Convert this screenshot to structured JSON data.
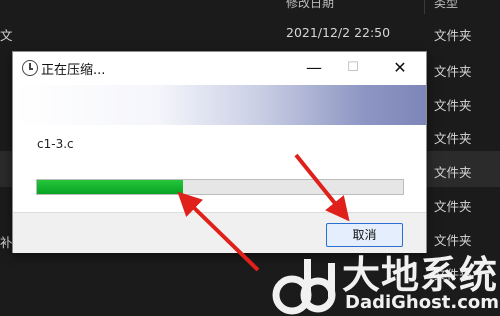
{
  "explorer": {
    "header_date": "修改日期",
    "header_type": "类型",
    "left_fragment_top": "文",
    "left_fragment_bottom": "补",
    "rows": [
      {
        "date": "2021/12/2 22:50",
        "type": "文件夹"
      },
      {
        "date": "",
        "type": "文件夹"
      },
      {
        "date": "",
        "type": "文件夹"
      },
      {
        "date": "",
        "type": "文件夹"
      },
      {
        "date": "",
        "type": "文件夹"
      },
      {
        "date": "",
        "type": "文件夹"
      },
      {
        "date": "",
        "type": "文件夹"
      },
      {
        "date": "",
        "type": "文件夹"
      }
    ]
  },
  "dialog": {
    "title": "正在压缩...",
    "filename": "c1-3.c",
    "progress": 0.4,
    "cancel_label": "取消",
    "minimize_glyph": "—",
    "maximize_glyph": "☐",
    "close_glyph": "✕"
  },
  "watermark": {
    "text": "大地系统",
    "url": "DadiGhost.com"
  },
  "colors": {
    "progress_fill": "#13b52b",
    "arrow": "#e0201a",
    "cancel_border": "#2a6fd6"
  },
  "icons": [
    "clock-icon",
    "minimize-icon",
    "maximize-icon",
    "close-icon"
  ]
}
